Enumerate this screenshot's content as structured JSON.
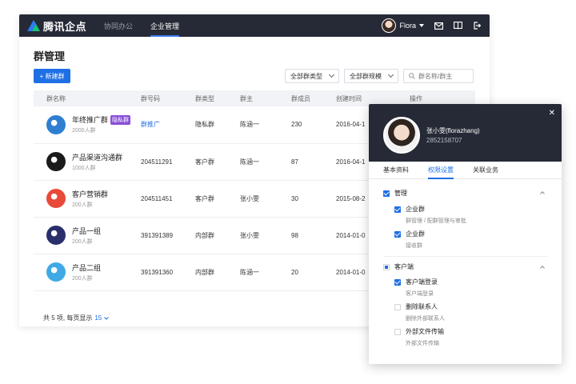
{
  "app": {
    "logo_text": "腾讯企点",
    "nav": [
      "协同办公",
      "企业管理"
    ],
    "user": "Flora"
  },
  "page": {
    "title": "群管理",
    "new_button": "+ 新建群",
    "filter_type": "全部群类型",
    "filter_scale": "全部群规模",
    "search_placeholder": "群名称/群主"
  },
  "table": {
    "headers": [
      "群名称",
      "群号码",
      "群类型",
      "群主",
      "群成员",
      "创建时间",
      "操作"
    ],
    "rows": [
      {
        "name": "年终推广群",
        "tag": "隐私群",
        "sub": "2000人群",
        "number": "群推广",
        "type": "隐私群",
        "owner": "陈涵一",
        "members": "230",
        "date": "2016-04-1",
        "avatar_color": "#2f7fd1"
      },
      {
        "name": "产品渠道沟通群",
        "tag": "",
        "sub": "1000人群",
        "number": "204511291",
        "type": "客户群",
        "owner": "陈涵一",
        "members": "87",
        "date": "2016-04-1",
        "avatar_color": "#1b1b1b"
      },
      {
        "name": "客户营销群",
        "tag": "",
        "sub": "200人群",
        "number": "204511451",
        "type": "客户群",
        "owner": "张小雯",
        "members": "30",
        "date": "2015-08-2",
        "avatar_color": "#e84a3a"
      },
      {
        "name": "产品一组",
        "tag": "",
        "sub": "200人群",
        "number": "391391389",
        "type": "内部群",
        "owner": "张小雯",
        "members": "98",
        "date": "2014-01-0",
        "avatar_color": "#2a2f6b"
      },
      {
        "name": "产品二组",
        "tag": "",
        "sub": "200人群",
        "number": "391391360",
        "type": "内部群",
        "owner": "陈涵一",
        "members": "20",
        "date": "2014-01-0",
        "avatar_color": "#3fa9e6"
      }
    ],
    "footer_prefix": "共 5 项, 每页显示",
    "footer_page_size": "15"
  },
  "drawer": {
    "name": "张小雯(florazhang)",
    "number": "2852158707",
    "tabs": [
      "基本资料",
      "权限设置",
      "关联业务"
    ],
    "sections": [
      {
        "label": "管理",
        "options": [
          {
            "label": "企业群",
            "desc": "群管理 / 配群管理与审批"
          },
          {
            "label": "企业群",
            "desc": "接收群"
          }
        ]
      },
      {
        "label": "客户端",
        "options": [
          {
            "label": "客户端登录",
            "desc": "客户端登录"
          },
          {
            "label": "删除联系人",
            "desc": "删除外部联系人"
          },
          {
            "label": "外部文件传输",
            "desc": "外部文件传输"
          }
        ]
      }
    ]
  }
}
